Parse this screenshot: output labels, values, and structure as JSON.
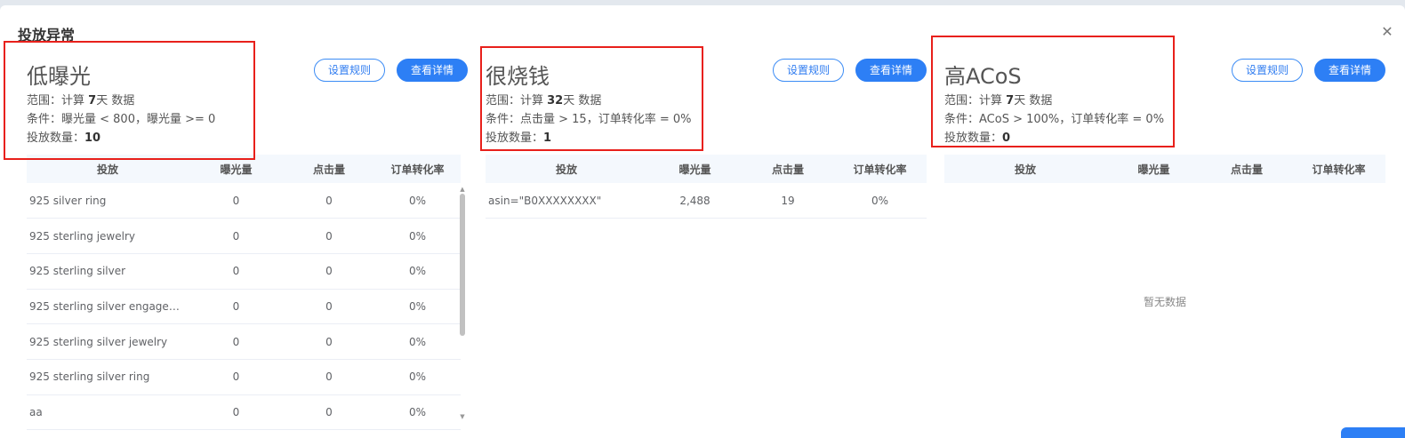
{
  "dialog": {
    "title": "投放异常"
  },
  "panels": [
    {
      "title": "低曝光",
      "scope_prefix": "范围：计算 ",
      "scope_days": "7",
      "scope_suffix": "天 数据",
      "condition": "条件：曝光量 < 800，曝光量 >= 0",
      "count_label": "投放数量：",
      "count_value": "10",
      "rules_label": "设置规则",
      "detail_label": "查看详情",
      "columns": [
        "投放",
        "曝光量",
        "点击量",
        "订单转化率"
      ],
      "rows": [
        [
          "925 silver ring",
          "0",
          "0",
          "0%"
        ],
        [
          "925 sterling jewelry",
          "0",
          "0",
          "0%"
        ],
        [
          "925 sterling silver",
          "0",
          "0",
          "0%"
        ],
        [
          "925 sterling silver engagement ...",
          "0",
          "0",
          "0%"
        ],
        [
          "925 sterling silver jewelry",
          "0",
          "0",
          "0%"
        ],
        [
          "925 sterling silver ring",
          "0",
          "0",
          "0%"
        ],
        [
          "aa",
          "0",
          "0",
          "0%"
        ]
      ]
    },
    {
      "title": "很烧钱",
      "scope_prefix": "范围：计算 ",
      "scope_days": "32",
      "scope_suffix": "天 数据",
      "condition": "条件：点击量 > 15，订单转化率 = 0%",
      "count_label": "投放数量：",
      "count_value": "1",
      "rules_label": "设置规则",
      "detail_label": "查看详情",
      "columns": [
        "投放",
        "曝光量",
        "点击量",
        "订单转化率"
      ],
      "rows": [
        [
          "asin=\"B0XXXXXXXX\"",
          "2,488",
          "19",
          "0%"
        ]
      ]
    },
    {
      "title": "高ACoS",
      "scope_prefix": "范围：计算 ",
      "scope_days": "7",
      "scope_suffix": "天 数据",
      "condition": "条件：ACoS > 100%，订单转化率 = 0%",
      "count_label": "投放数量：",
      "count_value": "0",
      "rules_label": "设置规则",
      "detail_label": "查看详情",
      "columns": [
        "投放",
        "曝光量",
        "点击量",
        "订单转化率"
      ],
      "rows": [],
      "empty_text": "暂无数据"
    }
  ]
}
